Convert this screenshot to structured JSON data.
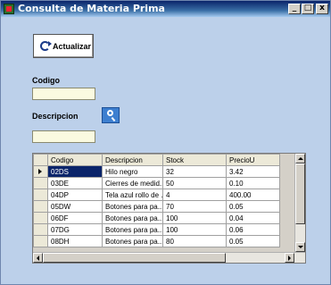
{
  "window": {
    "title": "Consulta de Materia Prima",
    "controls": {
      "minimize": "_",
      "maximize": "□",
      "close": "x"
    }
  },
  "form": {
    "refresh_button": {
      "label": "Actualizar",
      "icon": "refresh-icon"
    },
    "codigo": {
      "label": "Codigo",
      "value": ""
    },
    "descripcion": {
      "label": "Descripcion",
      "value": ""
    },
    "search_button": {
      "icon": "search-icon"
    }
  },
  "grid": {
    "columns": [
      "Codigo",
      "Descripcion",
      "Stock",
      "PrecioU"
    ],
    "rows": [
      {
        "codigo": "02DS",
        "descripcion": "Hilo negro",
        "stock": "32",
        "precio": "3.42"
      },
      {
        "codigo": "03DE",
        "descripcion": "Cierres de medid...",
        "stock": "50",
        "precio": "0.10"
      },
      {
        "codigo": "04DP",
        "descripcion": "Tela azul rollo de ...",
        "stock": "4",
        "precio": "400.00"
      },
      {
        "codigo": "05DW",
        "descripcion": "Botones para pa...",
        "stock": "70",
        "precio": "0.05"
      },
      {
        "codigo": "06DF",
        "descripcion": "Botones para pa...",
        "stock": "100",
        "precio": "0.04"
      },
      {
        "codigo": "07DG",
        "descripcion": "Botones para pa...",
        "stock": "100",
        "precio": "0.06"
      },
      {
        "codigo": "08DH",
        "descripcion": "Botones para pa...",
        "stock": "80",
        "precio": "0.05"
      }
    ],
    "selected_row": 0
  },
  "colors": {
    "background": "#bcd0ea",
    "selection": "#0a246a",
    "input_bg": "#fafae0"
  }
}
